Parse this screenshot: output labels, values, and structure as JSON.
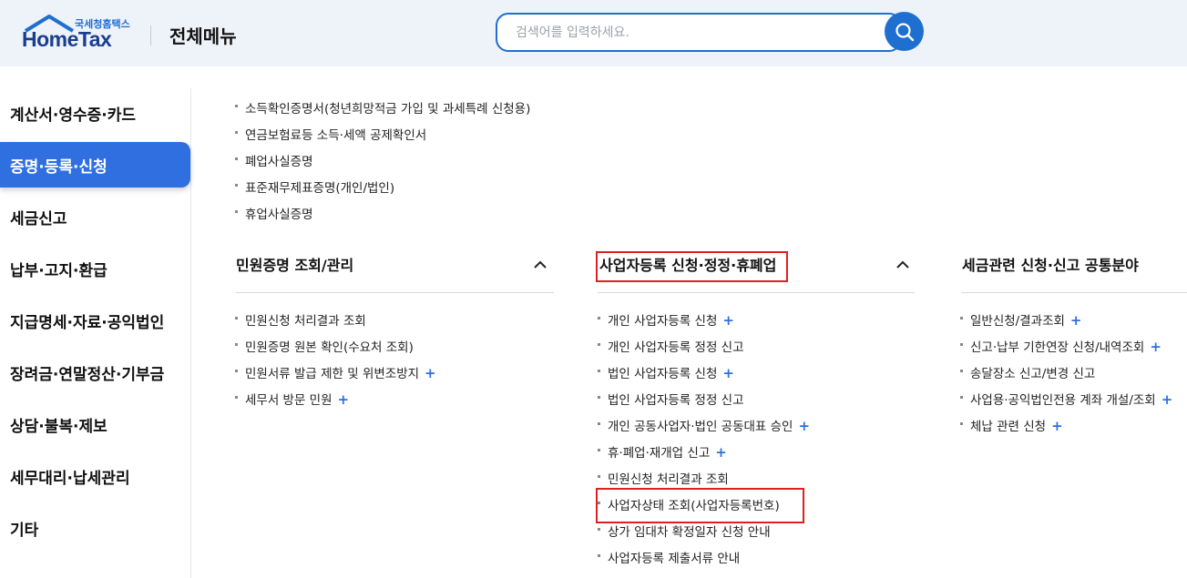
{
  "header": {
    "logo_sub": "국세청홈택스",
    "logo_main": "HomeTax",
    "title": "전체메뉴",
    "search_placeholder": "검색어를 입력하세요."
  },
  "sidebar": {
    "items": [
      {
        "label": "계산서·영수증·카드"
      },
      {
        "label": "증명·등록·신청",
        "active": true
      },
      {
        "label": "세금신고"
      },
      {
        "label": "납부·고지·환급"
      },
      {
        "label": "지급명세·자료·공익법인"
      },
      {
        "label": "장려금·연말정산·기부금"
      },
      {
        "label": "상담·불복·제보"
      },
      {
        "label": "세무대리·납세관리"
      },
      {
        "label": "기타"
      }
    ]
  },
  "top_list": {
    "items": [
      {
        "label": "소득확인증명서(청년희망적금 가입 및 과세특례 신청용)"
      },
      {
        "label": "연금보험료등 소득·세액 공제확인서"
      },
      {
        "label": "폐업사실증명"
      },
      {
        "label": "표준재무제표증명(개인/법인)"
      },
      {
        "label": "휴업사실증명"
      }
    ]
  },
  "sections": [
    {
      "title": "민원증명 조회/관리",
      "items": [
        {
          "label": "민원신청 처리결과 조회",
          "plus": ""
        },
        {
          "label": "민원증명 원본 확인(수요처 조회)",
          "plus": ""
        },
        {
          "label": "민원서류 발급 제한 및 위변조방지",
          "plus": "+"
        },
        {
          "label": "세무서 방문 민원",
          "plus": "+"
        }
      ]
    },
    {
      "title": "사업자등록 신청·정정·휴폐업",
      "items": [
        {
          "label": "개인 사업자등록 신청",
          "plus": "+"
        },
        {
          "label": "개인 사업자등록 정정 신고",
          "plus": ""
        },
        {
          "label": "법인 사업자등록 신청",
          "plus": "+"
        },
        {
          "label": "법인 사업자등록 정정 신고",
          "plus": ""
        },
        {
          "label": "개인 공동사업자·법인 공동대표 승인",
          "plus": "+"
        },
        {
          "label": "휴·폐업·재개업 신고",
          "plus": "+"
        },
        {
          "label": "민원신청 처리결과 조회",
          "plus": ""
        },
        {
          "label": "사업자상태 조회(사업자등록번호)",
          "plus": ""
        },
        {
          "label": "상가 임대차 확정일자 신청 안내",
          "plus": ""
        },
        {
          "label": "사업자등록 제출서류 안내",
          "plus": ""
        }
      ]
    },
    {
      "title": "세금관련 신청·신고 공통분야",
      "items": [
        {
          "label": "일반신청/결과조회",
          "plus": "+"
        },
        {
          "label": "신고·납부 기한연장 신청/내역조회",
          "plus": "+"
        },
        {
          "label": "송달장소 신고/변경 신고",
          "plus": ""
        },
        {
          "label": "사업용·공익법인전용 계좌 개설/조회",
          "plus": "+"
        },
        {
          "label": "체납 관련 신청",
          "plus": "+"
        }
      ]
    }
  ],
  "colors": {
    "accent": "#2f6fe0",
    "highlight": "#e02020",
    "header_bg": "#eef2f9"
  }
}
